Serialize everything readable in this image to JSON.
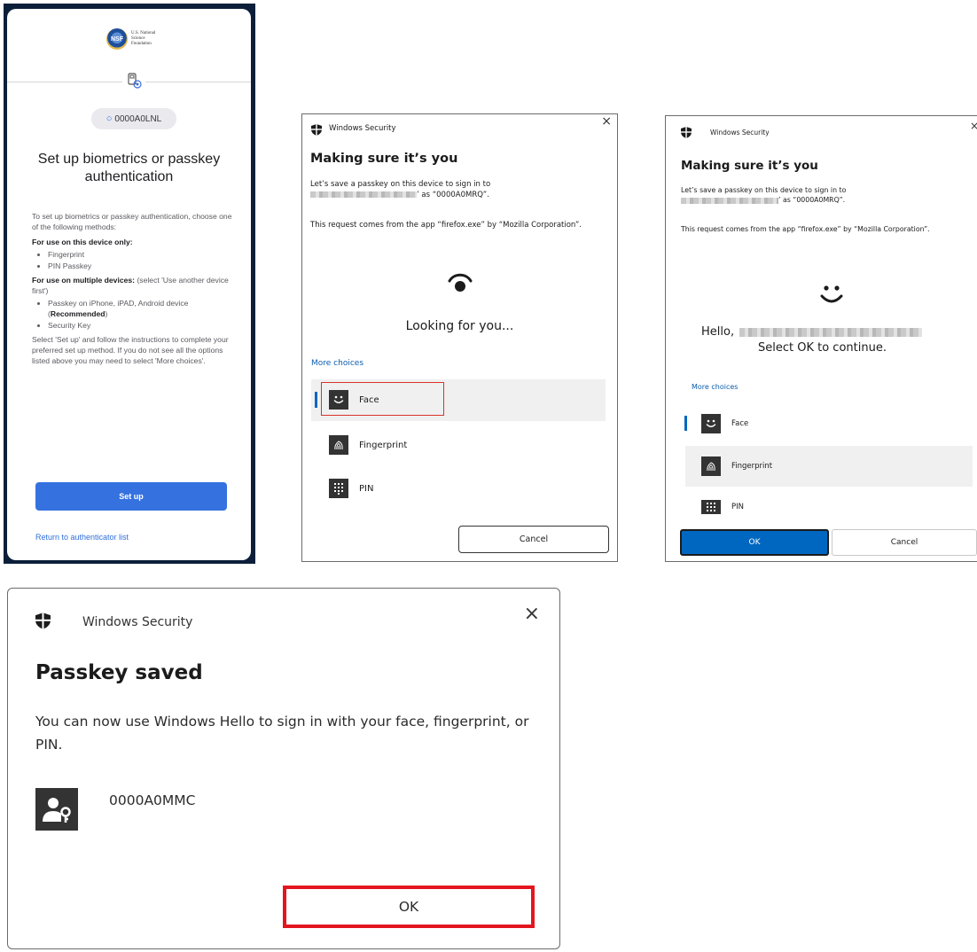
{
  "panel1": {
    "org_logo_text": [
      "U.S. National",
      "Science",
      "Foundation"
    ],
    "org_logo_seal": "NSF",
    "username": "0000A0LNL",
    "title": "Set up biometrics or passkey authentication",
    "intro": "To set up biometrics or passkey authentication, choose one of the following methods:",
    "device_only_heading": "For use on this device only:",
    "device_only_items": [
      "Fingerprint",
      "PIN Passkey"
    ],
    "multi_heading": "For use on multiple devices:",
    "multi_note": "(select 'Use another device first')",
    "multi_item1_prefix": "Passkey on iPhone, iPAD, Android device (",
    "multi_item1_bold": "Recommended",
    "multi_item1_suffix": ")",
    "multi_item2": "Security Key",
    "instructions": "Select 'Set up' and follow the instructions to complete your preferred set up method. If you do not see all the options listed above you may need to select 'More choices'.",
    "setup_button": "Set up",
    "return_link": "Return to authenticator list",
    "accent_color": "#3572e0"
  },
  "panel2": {
    "app_title": "Windows Security",
    "close_glyph": "×",
    "heading": "Making sure it’s you",
    "line1": "Let’s save a passkey on this device to sign in to",
    "line2_suffix": "’ as “0000A0MRQ”.",
    "request": "This request comes from the app “firefox.exe” by “Mozilla Corporation”.",
    "status": "Looking for you...",
    "more_choices": "More choices",
    "options": [
      "Face",
      "Fingerprint",
      "PIN"
    ],
    "cancel_button": "Cancel",
    "highlight_color": "#d9342b"
  },
  "panel3": {
    "app_title": "Windows Security",
    "close_glyph": "×",
    "heading": "Making sure it’s you",
    "line1": "Let’s save a passkey on this device to sign in to",
    "line2_suffix": "’ as “0000A0MRQ”.",
    "request": "This request comes from the app “firefox.exe” by “Mozilla Corporation”.",
    "hello_prefix": "Hello,",
    "continue_text": "Select OK to continue.",
    "more_choices": "More choices",
    "options": [
      "Face",
      "Fingerprint",
      "PIN"
    ],
    "ok_button": "OK",
    "cancel_button": "Cancel",
    "ok_color": "#0067c0"
  },
  "panel4": {
    "app_title": "Windows Security",
    "close_glyph": "×",
    "heading": "Passkey saved",
    "message": "You can now use Windows Hello to sign in with your face, fingerprint, or PIN.",
    "account": "0000A0MMC",
    "ok_button": "OK",
    "highlight_color": "#e3161f"
  }
}
